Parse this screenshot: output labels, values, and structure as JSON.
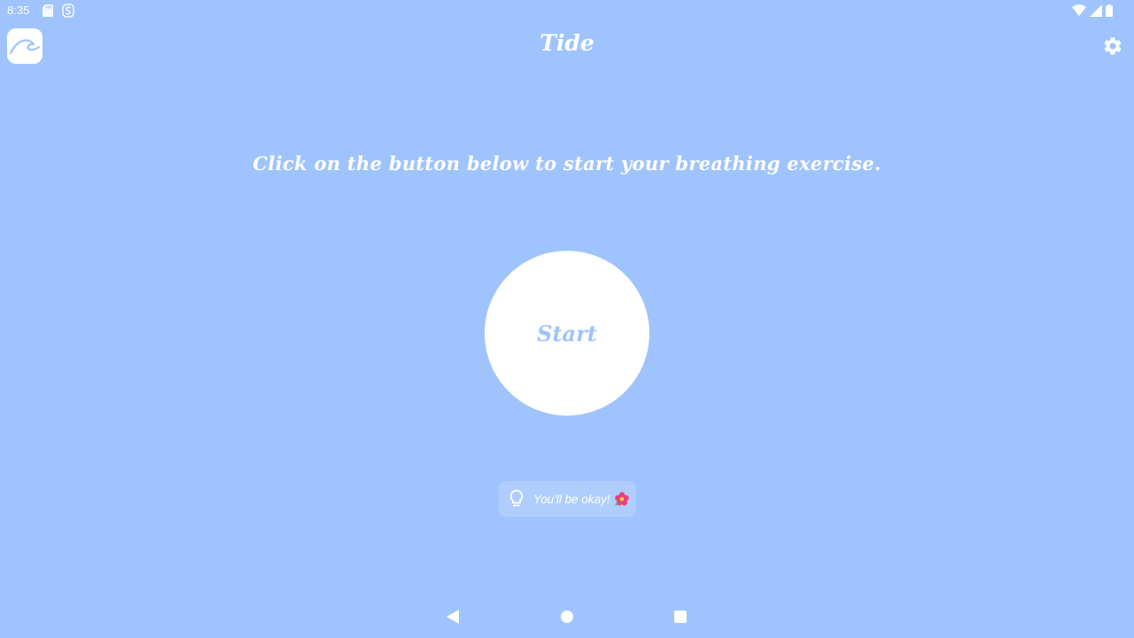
{
  "status_bar": {
    "time": "8:35",
    "icons": [
      "sd-card-icon",
      "s-notification-icon",
      "wifi-icon",
      "cell-signal-icon",
      "battery-icon"
    ]
  },
  "app_bar": {
    "title": "Tide",
    "app_icon": "wave-icon",
    "settings_icon": "gear-icon"
  },
  "main": {
    "instruction": "Click on the button below to start your breathing exercise.",
    "start_label": "Start"
  },
  "tip": {
    "icon": "lightbulb-icon",
    "text": "You'll be okay!",
    "emoji_icon": "hibiscus-icon"
  },
  "nav_bar": {
    "back_icon": "back-triangle-icon",
    "home_icon": "home-circle-icon",
    "recents_icon": "recents-square-icon"
  },
  "colors": {
    "background": "#9fc4fd",
    "foreground": "#ffffff",
    "accent": "#9fc4fd"
  }
}
